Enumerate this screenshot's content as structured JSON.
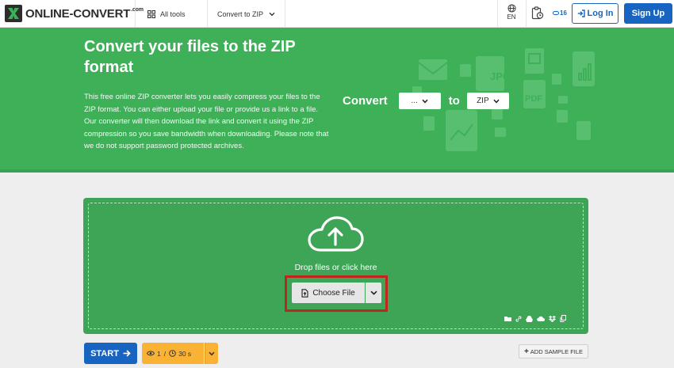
{
  "header": {
    "logo_text": "ONLINE-CONVERT",
    "logo_suffix": ".com",
    "nav_all_tools": "All tools",
    "nav_convert": "Convert to ZIP",
    "lang": "EN",
    "credits": "16",
    "login_label": "Log In",
    "signup_label": "Sign Up"
  },
  "hero": {
    "title": "Convert your files to the ZIP format",
    "description": "This free online ZIP converter lets you easily compress your files to the ZIP format. You can either upload your file or provide us a link to a file. Our converter will then download the link and convert it using the ZIP compression so you save bandwidth when downloading. Please note that we do not support password protected archives.",
    "convert_label": "Convert",
    "from_value": "...",
    "to_label": "to",
    "to_value": "ZIP"
  },
  "upload": {
    "drop_text": "Drop files or click here",
    "choose_label": "Choose File"
  },
  "actions": {
    "start_label": "START",
    "files_limit": "1",
    "time_limit": "30 s",
    "sample_label": "ADD SAMPLE FILE"
  },
  "colors": {
    "brand_green": "#3eb158",
    "dropzone_green": "#3ea556",
    "primary_blue": "#1765c1",
    "limits_orange": "#f9b233",
    "highlight_red": "#c0261d"
  }
}
